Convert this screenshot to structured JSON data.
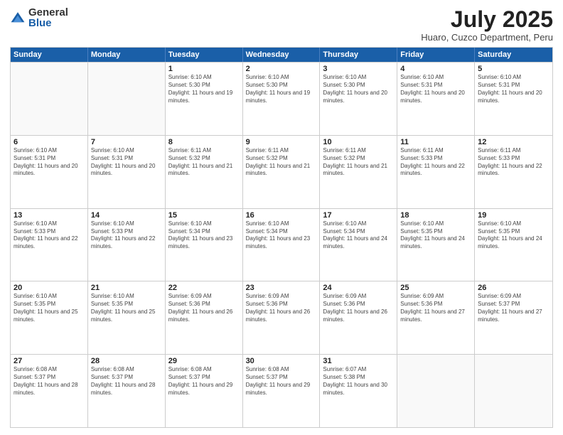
{
  "logo": {
    "general": "General",
    "blue": "Blue"
  },
  "header": {
    "month_year": "July 2025",
    "location": "Huaro, Cuzco Department, Peru"
  },
  "days": [
    "Sunday",
    "Monday",
    "Tuesday",
    "Wednesday",
    "Thursday",
    "Friday",
    "Saturday"
  ],
  "weeks": [
    [
      {
        "date": "",
        "sunrise": "",
        "sunset": "",
        "daylight": ""
      },
      {
        "date": "",
        "sunrise": "",
        "sunset": "",
        "daylight": ""
      },
      {
        "date": "1",
        "sunrise": "Sunrise: 6:10 AM",
        "sunset": "Sunset: 5:30 PM",
        "daylight": "Daylight: 11 hours and 19 minutes."
      },
      {
        "date": "2",
        "sunrise": "Sunrise: 6:10 AM",
        "sunset": "Sunset: 5:30 PM",
        "daylight": "Daylight: 11 hours and 19 minutes."
      },
      {
        "date": "3",
        "sunrise": "Sunrise: 6:10 AM",
        "sunset": "Sunset: 5:30 PM",
        "daylight": "Daylight: 11 hours and 20 minutes."
      },
      {
        "date": "4",
        "sunrise": "Sunrise: 6:10 AM",
        "sunset": "Sunset: 5:31 PM",
        "daylight": "Daylight: 11 hours and 20 minutes."
      },
      {
        "date": "5",
        "sunrise": "Sunrise: 6:10 AM",
        "sunset": "Sunset: 5:31 PM",
        "daylight": "Daylight: 11 hours and 20 minutes."
      }
    ],
    [
      {
        "date": "6",
        "sunrise": "Sunrise: 6:10 AM",
        "sunset": "Sunset: 5:31 PM",
        "daylight": "Daylight: 11 hours and 20 minutes."
      },
      {
        "date": "7",
        "sunrise": "Sunrise: 6:10 AM",
        "sunset": "Sunset: 5:31 PM",
        "daylight": "Daylight: 11 hours and 20 minutes."
      },
      {
        "date": "8",
        "sunrise": "Sunrise: 6:11 AM",
        "sunset": "Sunset: 5:32 PM",
        "daylight": "Daylight: 11 hours and 21 minutes."
      },
      {
        "date": "9",
        "sunrise": "Sunrise: 6:11 AM",
        "sunset": "Sunset: 5:32 PM",
        "daylight": "Daylight: 11 hours and 21 minutes."
      },
      {
        "date": "10",
        "sunrise": "Sunrise: 6:11 AM",
        "sunset": "Sunset: 5:32 PM",
        "daylight": "Daylight: 11 hours and 21 minutes."
      },
      {
        "date": "11",
        "sunrise": "Sunrise: 6:11 AM",
        "sunset": "Sunset: 5:33 PM",
        "daylight": "Daylight: 11 hours and 22 minutes."
      },
      {
        "date": "12",
        "sunrise": "Sunrise: 6:11 AM",
        "sunset": "Sunset: 5:33 PM",
        "daylight": "Daylight: 11 hours and 22 minutes."
      }
    ],
    [
      {
        "date": "13",
        "sunrise": "Sunrise: 6:10 AM",
        "sunset": "Sunset: 5:33 PM",
        "daylight": "Daylight: 11 hours and 22 minutes."
      },
      {
        "date": "14",
        "sunrise": "Sunrise: 6:10 AM",
        "sunset": "Sunset: 5:33 PM",
        "daylight": "Daylight: 11 hours and 22 minutes."
      },
      {
        "date": "15",
        "sunrise": "Sunrise: 6:10 AM",
        "sunset": "Sunset: 5:34 PM",
        "daylight": "Daylight: 11 hours and 23 minutes."
      },
      {
        "date": "16",
        "sunrise": "Sunrise: 6:10 AM",
        "sunset": "Sunset: 5:34 PM",
        "daylight": "Daylight: 11 hours and 23 minutes."
      },
      {
        "date": "17",
        "sunrise": "Sunrise: 6:10 AM",
        "sunset": "Sunset: 5:34 PM",
        "daylight": "Daylight: 11 hours and 24 minutes."
      },
      {
        "date": "18",
        "sunrise": "Sunrise: 6:10 AM",
        "sunset": "Sunset: 5:35 PM",
        "daylight": "Daylight: 11 hours and 24 minutes."
      },
      {
        "date": "19",
        "sunrise": "Sunrise: 6:10 AM",
        "sunset": "Sunset: 5:35 PM",
        "daylight": "Daylight: 11 hours and 24 minutes."
      }
    ],
    [
      {
        "date": "20",
        "sunrise": "Sunrise: 6:10 AM",
        "sunset": "Sunset: 5:35 PM",
        "daylight": "Daylight: 11 hours and 25 minutes."
      },
      {
        "date": "21",
        "sunrise": "Sunrise: 6:10 AM",
        "sunset": "Sunset: 5:35 PM",
        "daylight": "Daylight: 11 hours and 25 minutes."
      },
      {
        "date": "22",
        "sunrise": "Sunrise: 6:09 AM",
        "sunset": "Sunset: 5:36 PM",
        "daylight": "Daylight: 11 hours and 26 minutes."
      },
      {
        "date": "23",
        "sunrise": "Sunrise: 6:09 AM",
        "sunset": "Sunset: 5:36 PM",
        "daylight": "Daylight: 11 hours and 26 minutes."
      },
      {
        "date": "24",
        "sunrise": "Sunrise: 6:09 AM",
        "sunset": "Sunset: 5:36 PM",
        "daylight": "Daylight: 11 hours and 26 minutes."
      },
      {
        "date": "25",
        "sunrise": "Sunrise: 6:09 AM",
        "sunset": "Sunset: 5:36 PM",
        "daylight": "Daylight: 11 hours and 27 minutes."
      },
      {
        "date": "26",
        "sunrise": "Sunrise: 6:09 AM",
        "sunset": "Sunset: 5:37 PM",
        "daylight": "Daylight: 11 hours and 27 minutes."
      }
    ],
    [
      {
        "date": "27",
        "sunrise": "Sunrise: 6:08 AM",
        "sunset": "Sunset: 5:37 PM",
        "daylight": "Daylight: 11 hours and 28 minutes."
      },
      {
        "date": "28",
        "sunrise": "Sunrise: 6:08 AM",
        "sunset": "Sunset: 5:37 PM",
        "daylight": "Daylight: 11 hours and 28 minutes."
      },
      {
        "date": "29",
        "sunrise": "Sunrise: 6:08 AM",
        "sunset": "Sunset: 5:37 PM",
        "daylight": "Daylight: 11 hours and 29 minutes."
      },
      {
        "date": "30",
        "sunrise": "Sunrise: 6:08 AM",
        "sunset": "Sunset: 5:37 PM",
        "daylight": "Daylight: 11 hours and 29 minutes."
      },
      {
        "date": "31",
        "sunrise": "Sunrise: 6:07 AM",
        "sunset": "Sunset: 5:38 PM",
        "daylight": "Daylight: 11 hours and 30 minutes."
      },
      {
        "date": "",
        "sunrise": "",
        "sunset": "",
        "daylight": ""
      },
      {
        "date": "",
        "sunrise": "",
        "sunset": "",
        "daylight": ""
      }
    ]
  ]
}
